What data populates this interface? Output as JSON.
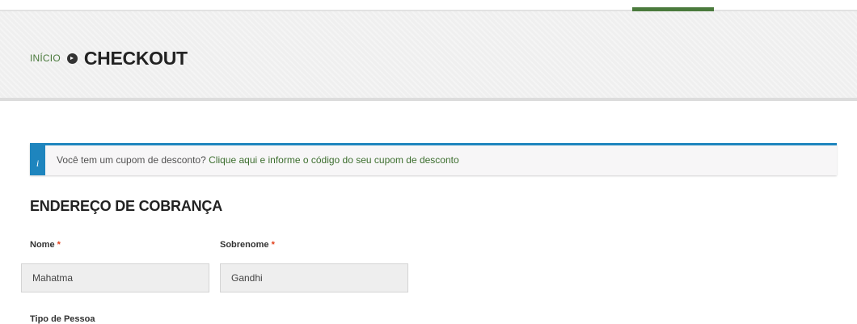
{
  "breadcrumb": {
    "home": "INÍCIO",
    "current": "CHECKOUT"
  },
  "coupon_notice": {
    "icon": "info-icon",
    "icon_glyph": "i",
    "text": "Você tem um cupom de desconto?",
    "link": "Clique aqui e informe o código do seu cupom de desconto"
  },
  "billing": {
    "title": "ENDEREÇO DE COBRANÇA",
    "first_name": {
      "label": "Nome",
      "required_mark": "*",
      "value": "Mahatma"
    },
    "last_name": {
      "label": "Sobrenome",
      "required_mark": "*",
      "value": "Gandhi"
    },
    "person_type": {
      "label": "Tipo de Pessoa"
    }
  },
  "colors": {
    "accent_green": "#4a7a3c",
    "info_blue": "#1e85be",
    "required_red": "#e2401c"
  }
}
